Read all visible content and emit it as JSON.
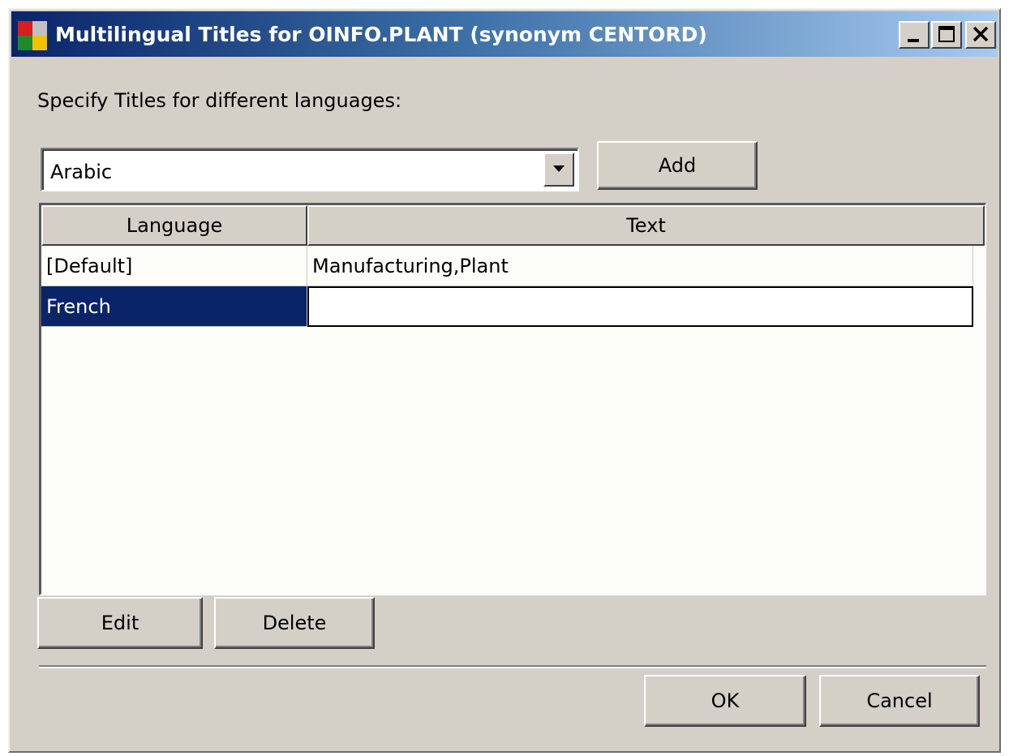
{
  "window": {
    "title": "Multilingual Titles for OINFO.PLANT (synonym CENTORD)",
    "icon": "app-logo-icon",
    "controls": [
      "minimize-icon",
      "maximize-icon",
      "close-icon"
    ]
  },
  "prompt": "Specify Titles for different languages:",
  "language_select": {
    "value": "Arabic",
    "dropdown_icon": "chevron-down-icon"
  },
  "buttons": {
    "add": "Add",
    "edit": "Edit",
    "delete": "Delete",
    "ok": "OK",
    "cancel": "Cancel"
  },
  "table": {
    "columns": [
      "Language",
      "Text"
    ],
    "rows": [
      {
        "language": "[Default]",
        "text": "Manufacturing,Plant"
      },
      {
        "language": "French",
        "text": ""
      }
    ],
    "selected_row": 1
  },
  "colors": {
    "title_bar_start": "#0a246a",
    "title_bar_end": "#a6caf0",
    "selection": "#0a246a",
    "face": "#d4d0c8"
  }
}
